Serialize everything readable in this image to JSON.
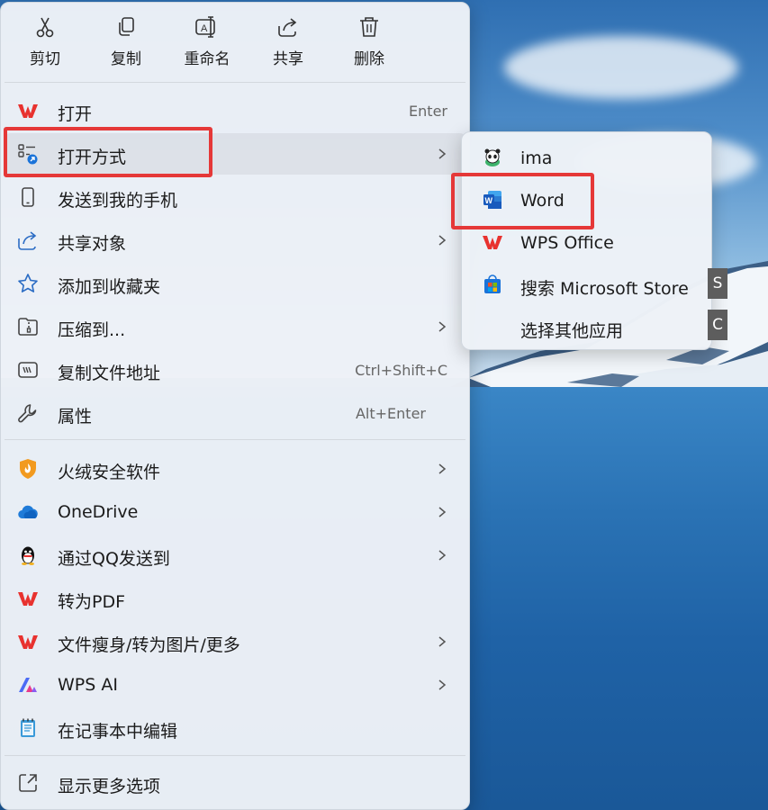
{
  "quick_actions": {
    "cut": "剪切",
    "copy": "复制",
    "rename": "重命名",
    "share": "共享",
    "delete": "删除"
  },
  "menu_items": {
    "open": {
      "label": "打开",
      "shortcut": "Enter",
      "icon": "wps-icon"
    },
    "open_with": {
      "label": "打开方式",
      "icon": "open-with-icon"
    },
    "send_to_phone": {
      "label": "发送到我的手机",
      "icon": "phone-icon"
    },
    "share_object": {
      "label": "共享对象",
      "icon": "share-icon"
    },
    "add_favorites": {
      "label": "添加到收藏夹",
      "icon": "star-icon"
    },
    "compress": {
      "label": "压缩到...",
      "icon": "zip-icon"
    },
    "copy_path": {
      "label": "复制文件地址",
      "shortcut": "Ctrl+Shift+C",
      "icon": "path-icon"
    },
    "properties": {
      "label": "属性",
      "shortcut": "Alt+Enter",
      "icon": "wrench-icon"
    },
    "huorong": {
      "label": "火绒安全软件",
      "icon": "huorong-icon"
    },
    "onedrive": {
      "label": "OneDrive",
      "icon": "cloud-icon"
    },
    "send_qq": {
      "label": "通过QQ发送到",
      "icon": "qq-icon"
    },
    "to_pdf": {
      "label": "转为PDF",
      "icon": "wps-icon"
    },
    "slim": {
      "label": "文件瘦身/转为图片/更多",
      "icon": "wps-icon"
    },
    "wps_ai": {
      "label": "WPS AI",
      "icon": "wps-ai-icon"
    },
    "notepad": {
      "label": "在记事本中编辑",
      "icon": "notepad-icon"
    },
    "more_options": {
      "label": "显示更多选项",
      "icon": "expand-icon"
    }
  },
  "submenu": {
    "ima": {
      "label": "ima",
      "icon": "panda-icon"
    },
    "word": {
      "label": "Word",
      "icon": "word-icon"
    },
    "wps_office": {
      "label": "WPS Office",
      "icon": "wps-icon"
    },
    "store": {
      "label": "搜索 Microsoft Store",
      "icon": "store-icon",
      "access_key": "S"
    },
    "other": {
      "label": "选择其他应用",
      "access_key": "C"
    }
  },
  "colors": {
    "highlight": "#e53838",
    "wps_red": "#e8322f",
    "word_blue": "#185abd",
    "accent_blue": "#1a73d9"
  }
}
